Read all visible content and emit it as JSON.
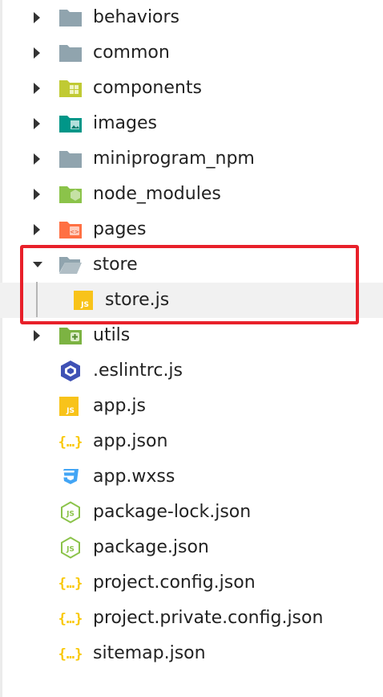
{
  "colors": {
    "folder_gray": "#90a4ae",
    "components_green": "#c0ca33",
    "images_teal": "#009688",
    "node_green": "#8bc34a",
    "pages_orange": "#ff7043",
    "json_yellow": "#f9c802",
    "js_yellow": "#f8c31a",
    "css_blue": "#42a5f5",
    "eslint_blue": "#3f51b5",
    "highlight_red": "#e8202a"
  },
  "tree": {
    "items": [
      {
        "label": "behaviors",
        "icon": "folder-icon",
        "expanded": false
      },
      {
        "label": "common",
        "icon": "folder-icon",
        "expanded": false
      },
      {
        "label": "components",
        "icon": "components-folder-icon",
        "expanded": false
      },
      {
        "label": "images",
        "icon": "images-folder-icon",
        "expanded": false
      },
      {
        "label": "miniprogram_npm",
        "icon": "folder-icon",
        "expanded": false
      },
      {
        "label": "node_modules",
        "icon": "node-folder-icon",
        "expanded": false
      },
      {
        "label": "pages",
        "icon": "pages-folder-icon",
        "expanded": false
      },
      {
        "label": "store",
        "icon": "open-folder-icon",
        "expanded": true
      },
      {
        "label": "store.js",
        "icon": "js-file-icon",
        "selected": true
      },
      {
        "label": "utils",
        "icon": "utils-folder-icon",
        "expanded": false
      },
      {
        "label": ".eslintrc.js",
        "icon": "eslint-icon"
      },
      {
        "label": "app.js",
        "icon": "js-file-icon"
      },
      {
        "label": "app.json",
        "icon": "json-icon"
      },
      {
        "label": "app.wxss",
        "icon": "css-icon"
      },
      {
        "label": "package-lock.json",
        "icon": "node-js-icon"
      },
      {
        "label": "package.json",
        "icon": "node-js-icon"
      },
      {
        "label": "project.config.json",
        "icon": "json-icon"
      },
      {
        "label": "project.private.config.json",
        "icon": "json-icon"
      },
      {
        "label": "sitemap.json",
        "icon": "json-icon"
      }
    ]
  }
}
